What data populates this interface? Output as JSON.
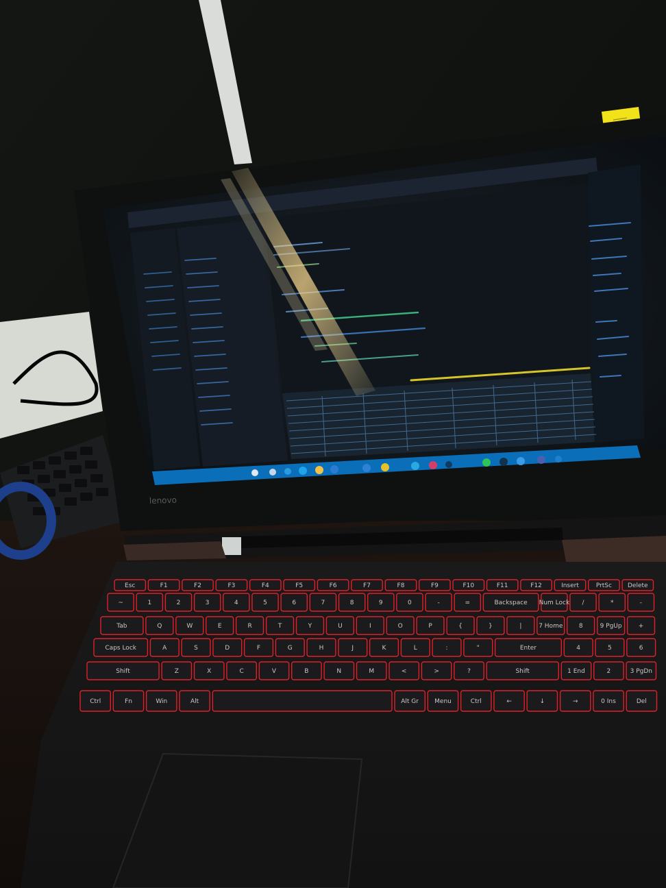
{
  "photo": {
    "colors": {
      "wall": "#121412",
      "screen_bg": "#0e1216",
      "taskbar": "#0a6fb8",
      "key_backlight": "#e0202a",
      "sticky_note": "#f2e21a",
      "glare": "#f3d28a"
    }
  },
  "laptop": {
    "brand": "Lenovo",
    "sticky_note": "",
    "screen": {
      "app": "code editor with data table output (illegible)",
      "taskbar_icons": [
        "start-icon",
        "search-icon",
        "task-view-icon",
        "browser-icon",
        "folder-icon",
        "store-icon",
        "mail-icon",
        "chrome-icon",
        "editor-icon",
        "whatsapp-icon",
        "terminal-icon",
        "settings-icon"
      ]
    },
    "keyboard": {
      "rows": [
        [
          "Esc",
          "F1",
          "F2",
          "F3",
          "F4",
          "F5",
          "F6",
          "F7",
          "F8",
          "F9",
          "F10",
          "F11",
          "F12",
          "Insert",
          "PrtSc",
          "Delete"
        ],
        [
          "~",
          "1",
          "2",
          "3",
          "4",
          "5",
          "6",
          "7",
          "8",
          "9",
          "0",
          "-",
          "=",
          "Backspace",
          "Num Lock",
          "/",
          "*",
          "-"
        ],
        [
          "Tab",
          "Q",
          "W",
          "E",
          "R",
          "T",
          "Y",
          "U",
          "I",
          "O",
          "P",
          "{",
          "}",
          "|",
          "7 Home",
          "8",
          "9 PgUp",
          "+"
        ],
        [
          "Caps Lock",
          "A",
          "S",
          "D",
          "F",
          "G",
          "H",
          "J",
          "K",
          "L",
          ":",
          "\"",
          "Enter",
          "4",
          "5",
          "6"
        ],
        [
          "Shift",
          "Z",
          "X",
          "C",
          "V",
          "B",
          "N",
          "M",
          "<",
          ">",
          "?",
          "Shift",
          "1 End",
          "2",
          "3 PgDn"
        ],
        [
          "Ctrl",
          "Fn",
          "Win",
          "Alt",
          "",
          "Alt Gr",
          "Menu",
          "Ctrl",
          "←",
          "↓",
          "→",
          "0 Ins",
          "Del"
        ]
      ]
    }
  }
}
